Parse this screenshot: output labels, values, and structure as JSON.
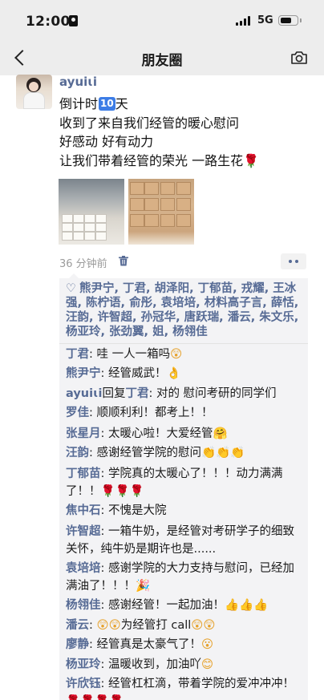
{
  "status_bar": {
    "time": "12:00",
    "network": "5G",
    "battery_level": 0.6
  },
  "nav": {
    "title": "朋友圈"
  },
  "post": {
    "username": "ayuiɩi",
    "lines": [
      "倒计时",
      "天",
      "收到了来自我们经管的暖心慰问",
      "好感动 好有动力",
      "让我们带着经管的荣光 一路生花"
    ],
    "badge": "10",
    "time_ago": "36 分钟前"
  },
  "likes": {
    "names": "熊尹宁, 丁君, 胡泽阳, 丁郁苗, 戎耀, 王冰强, 陈柠语, 俞彤, 袁培培, 材料高子言, 薛恬, 汪韵, 许智超, 孙冠华, 唐跃瑞, 潘云, 朱文乐, 杨亚玲, 张劲翼, 姐, 杨翎佳"
  },
  "comments": [
    {
      "name": "丁君",
      "sep": ": ",
      "text": "哇 一人一箱吗",
      "emoji": "😲"
    },
    {
      "name": "熊尹宁",
      "sep": ": ",
      "text": "经管威武！",
      "emoji": "👌"
    },
    {
      "name": "ayuiɩi",
      "sep": "",
      "reply": "回复",
      "target": "丁君",
      "text2": ": 对的 慰问考研的同学们"
    },
    {
      "name": "罗佳",
      "sep": ": ",
      "text": "顺顺利利！都考上！！"
    },
    {
      "name": "张星月",
      "sep": ": ",
      "text": "太暖心啦！大爱经管",
      "emoji": "🤗"
    },
    {
      "name": "汪韵",
      "sep": ": ",
      "text": "感谢经管学院的慰问",
      "emoji": "👏👏👏"
    },
    {
      "name": "丁郁苗",
      "sep": ": ",
      "text": "学院真的太暖心了！！！动力满满了！！",
      "emoji": "🌹🌹🌹"
    },
    {
      "name": "焦中石",
      "sep": ": ",
      "text": "不愧是大院"
    },
    {
      "name": "许智超",
      "sep": ": ",
      "text": "一箱牛奶，是经管对考研学子的细致关怀，纯牛奶是期许也是......"
    },
    {
      "name": "袁培培",
      "sep": ": ",
      "text": "感谢学院的大力支持与慰问，已经加满油了！！！",
      "emoji": "🎉"
    },
    {
      "name": "杨翎佳",
      "sep": ": ",
      "text": "感谢经管！一起加油！",
      "emoji": "👍👍👍"
    },
    {
      "name": "潘云",
      "sep": ": ",
      "emoji_pre": "😲😲",
      "text": "为经管打 call",
      "emoji": "😲😲"
    },
    {
      "name": "廖静",
      "sep": ": ",
      "text": "经管真是太豪气了！",
      "emoji": "😮"
    },
    {
      "name": "杨亚玲",
      "sep": ": ",
      "text": "温暖收到，加油吖",
      "emoji": "😊"
    },
    {
      "name": "许欣钰",
      "sep": ": ",
      "text": "经管杠杠滴，带着学院的爱冲冲冲！",
      "emoji": "🌹🌹🌹🌹"
    }
  ],
  "colors": {
    "link": "#576b95",
    "badge": "#3d7de6"
  }
}
